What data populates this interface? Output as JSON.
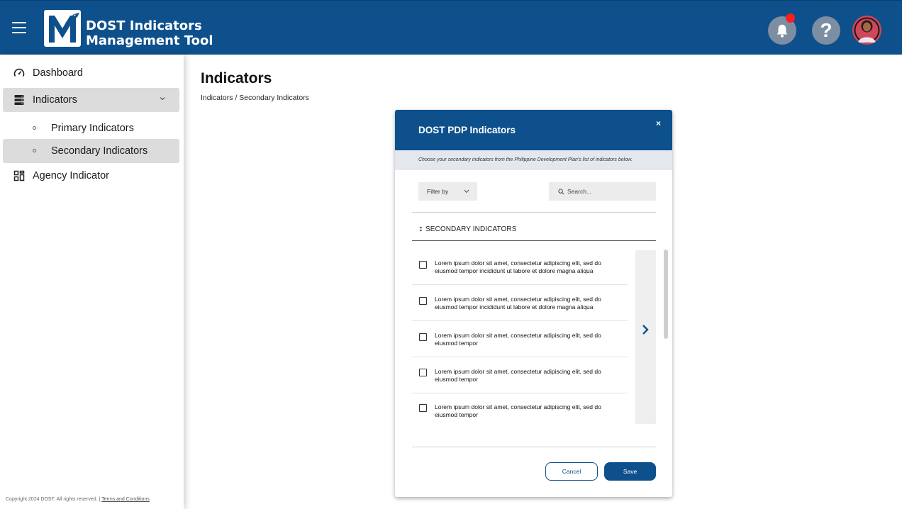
{
  "app": {
    "title_line1": "DOST Indicators",
    "title_line2": "Management Tool"
  },
  "colors": {
    "primary": "#0d508c",
    "notification": "#ff1d1d",
    "active_nav": "#dcdcdc"
  },
  "header": {
    "icons": [
      "hamburger-menu-icon",
      "bell-icon",
      "help-icon",
      "avatar"
    ],
    "help_glyph": "?"
  },
  "sidebar": {
    "items": [
      {
        "label": "Dashboard",
        "icon": "dashboard-gauge-icon"
      },
      {
        "label": "Indicators",
        "icon": "server-stack-icon",
        "expanded": true,
        "children": [
          {
            "label": "Primary Indicators"
          },
          {
            "label": "Secondary Indicators",
            "selected": true
          }
        ]
      },
      {
        "label": "Agency Indicator",
        "icon": "grid-apps-icon"
      }
    ],
    "footer_copyright": "Copyright 2024 DOST. All rights reserved. | ",
    "footer_link": "Terms and Conditions"
  },
  "main": {
    "page_title": "Indicators",
    "breadcrumb": "Indicators / Secondary Indicators"
  },
  "modal": {
    "title": "DOST PDP Indicators",
    "close_glyph": "×",
    "subtitle": "Choose your secondary indicators from the Philippine Development Plan's list of indicators below.",
    "filter_label": "Filter by",
    "search_placeholder": "Search...",
    "column_header": "SECONDARY INDICATORS",
    "rows": [
      {
        "text": "Lorem ipsum dolor sit amet, consectetur adipiscing elit, sed do eiusmod tempor incididunt ut labore et dolore magna aliqua",
        "checked": false
      },
      {
        "text": "Lorem ipsum dolor sit amet, consectetur adipiscing elit, sed do eiusmod tempor incididunt ut labore et dolore magna aliqua",
        "checked": false
      },
      {
        "text": "Lorem ipsum dolor sit amet, consectetur adipiscing elit, sed do eiusmod tempor",
        "checked": false
      },
      {
        "text": "Lorem ipsum dolor sit amet, consectetur adipiscing elit, sed do eiusmod tempor",
        "checked": false
      },
      {
        "text": "Lorem ipsum dolor sit amet, consectetur adipiscing elit, sed do eiusmod tempor",
        "checked": false
      }
    ],
    "cancel_label": "Cancel",
    "save_label": "Save"
  }
}
